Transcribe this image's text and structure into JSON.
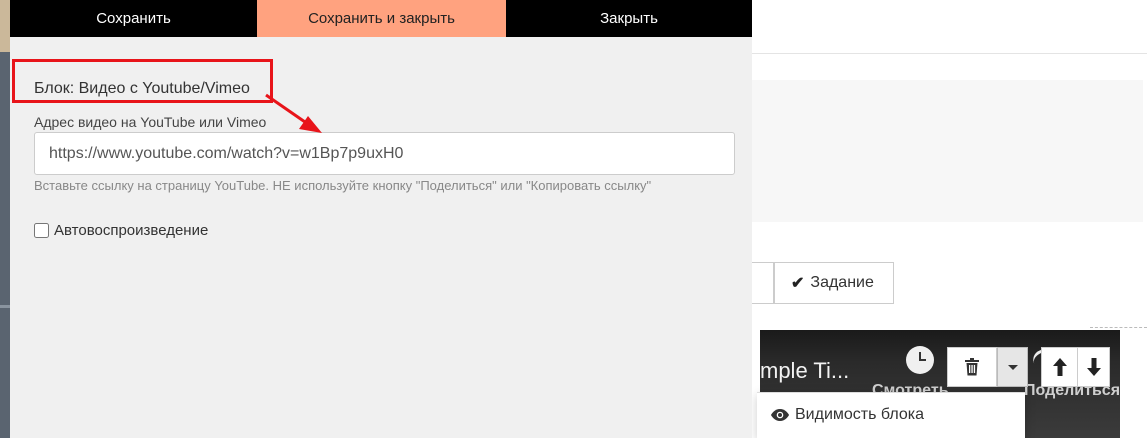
{
  "toolbar": {
    "save_label": "Сохранить",
    "save_close_label": "Сохранить и закрыть",
    "close_label": "Закрыть"
  },
  "form": {
    "block_title": "Блок: Видео с Youtube/Vimeo",
    "url_label": "Адрес видео на YouTube или Vimeo",
    "url_value": "https://www.youtube.com/watch?v=w1Bp7p9uxH0",
    "help_text": "Вставьте ссылку на страницу YouTube. НЕ используйте кнопку \"Поделиться\" или \"Копировать ссылку\"",
    "autoplay_label": "Автовоспроизведение",
    "autoplay_checked": false
  },
  "background": {
    "task_button_label": "Задание",
    "video_title_fragment": "mple Ti...",
    "watch_label": "Смотреть",
    "share_label": "Поделиться",
    "visibility_label": "Видимость блока"
  },
  "colors": {
    "accent_tab": "#ffa27f",
    "toolbar_bg": "#000000",
    "panel_bg": "#f0f0f0",
    "annotation": "#e8141a"
  },
  "icons": {
    "check": "check-icon",
    "clock": "clock-icon",
    "trash": "trash-icon",
    "caret": "caret-down-icon",
    "up": "arrow-up-icon",
    "down": "arrow-down-icon",
    "eye": "eye-icon"
  }
}
